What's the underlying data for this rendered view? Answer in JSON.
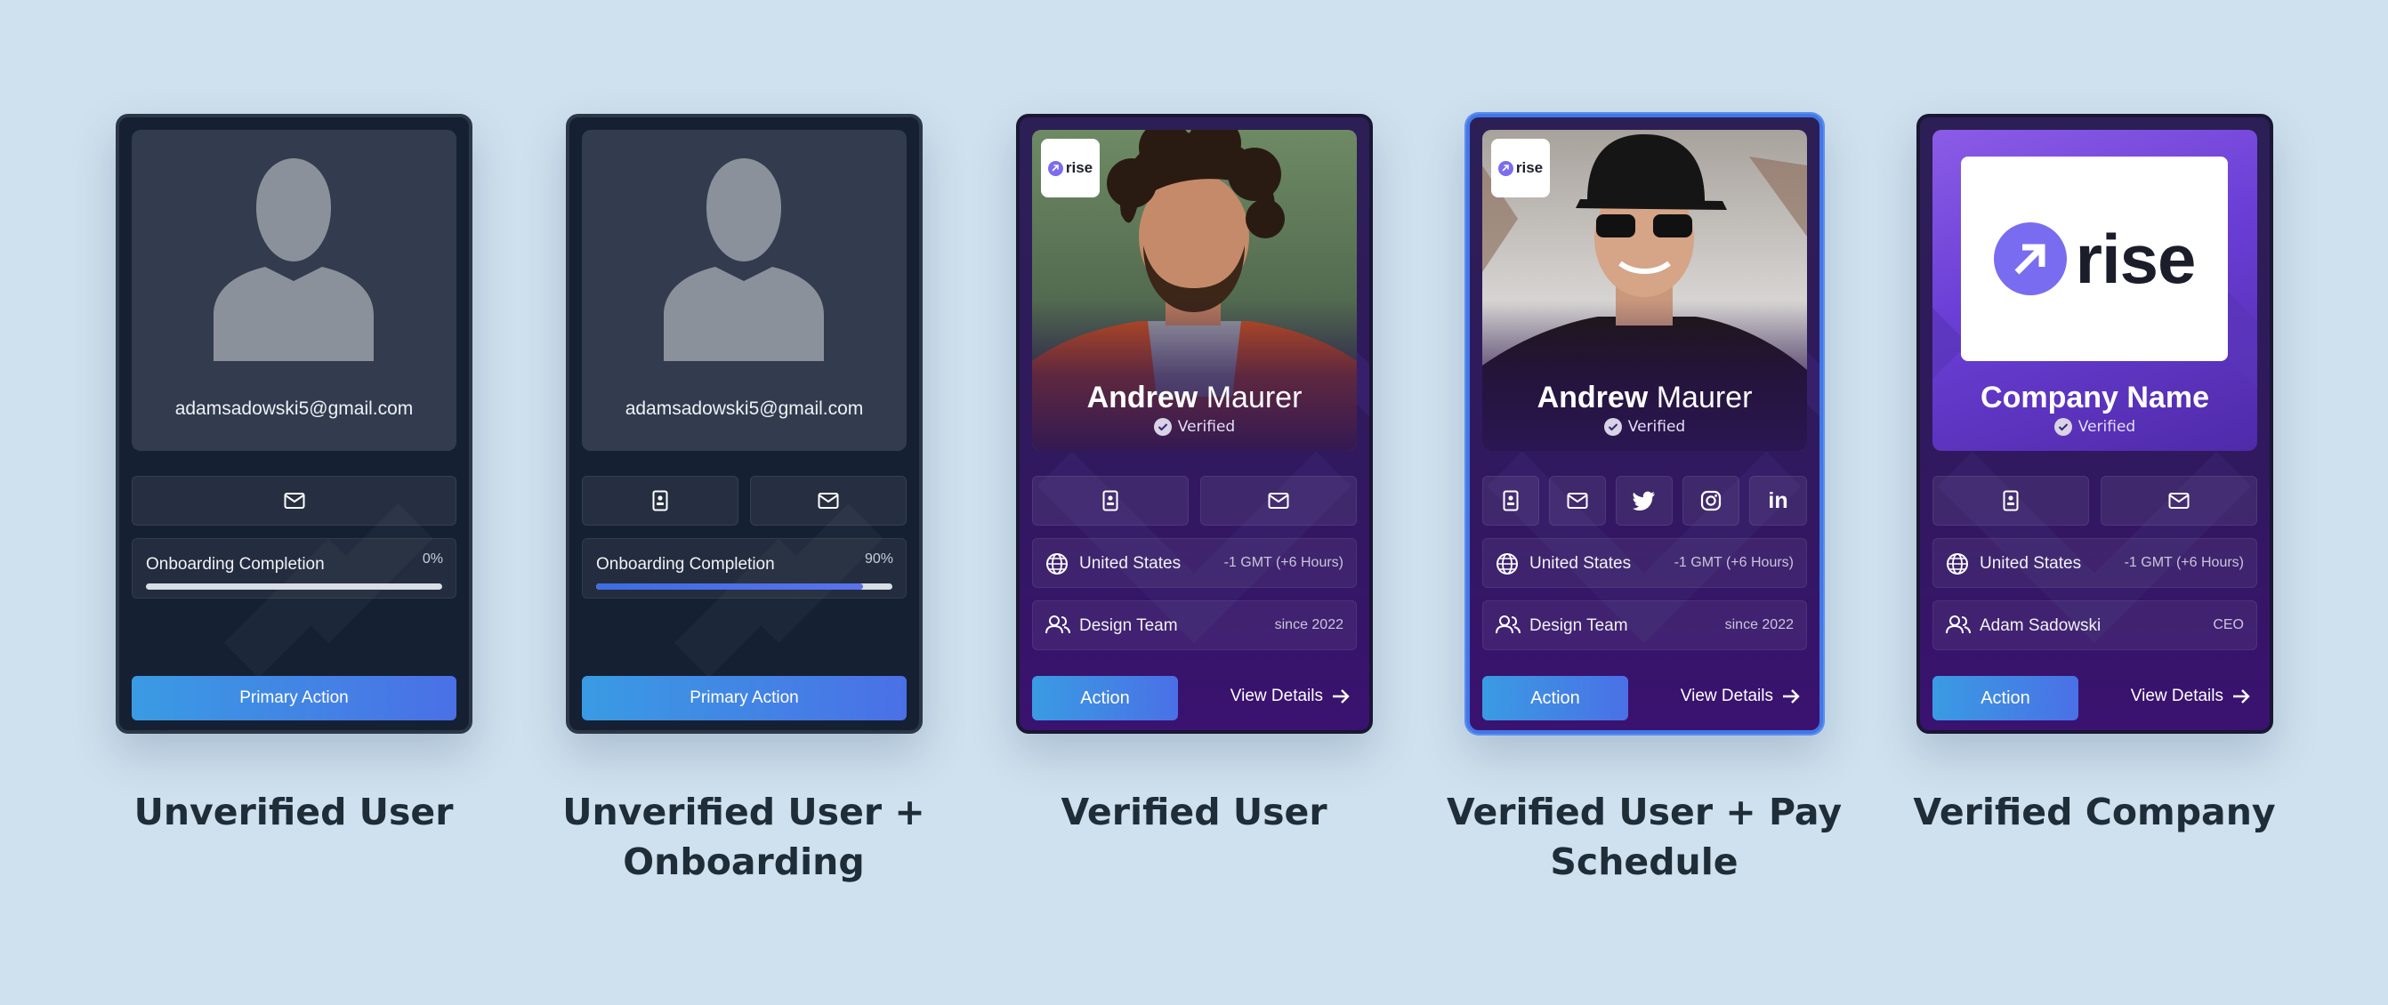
{
  "cards": [
    {
      "caption": [
        "Unverified User"
      ],
      "email": "adamsadowski5@gmail.com",
      "progress_label": "Onboarding Completion",
      "progress_value": "0%",
      "progress_fraction": 0,
      "button": "Primary Action",
      "icons": [
        "mail-icon"
      ]
    },
    {
      "caption": [
        "Unverified User +",
        "Onboarding"
      ],
      "email": "adamsadowski5@gmail.com",
      "progress_label": "Onboarding Completion",
      "progress_value": "90%",
      "progress_fraction": 0.9,
      "button": "Primary Action",
      "icons": [
        "id-card-icon",
        "mail-icon"
      ]
    },
    {
      "caption": [
        "Verified User"
      ],
      "logo": "rise",
      "first_name": "Andrew",
      "last_name": "Maurer",
      "verified": "Verified",
      "country": "United States",
      "timezone": "-1 GMT (+6 Hours)",
      "team": "Design Team",
      "since": "since 2022",
      "action": "Action",
      "details": "View Details",
      "icons": [
        "id-card-icon",
        "mail-icon"
      ]
    },
    {
      "caption": [
        "Verified User + Pay",
        "Schedule"
      ],
      "logo": "rise",
      "first_name": "Andrew",
      "last_name": "Maurer",
      "verified": "Verified",
      "country": "United States",
      "timezone": "-1 GMT (+6 Hours)",
      "team": "Design Team",
      "since": "since 2022",
      "action": "Action",
      "details": "View Details",
      "icons": [
        "id-card-icon",
        "mail-icon",
        "twitter-icon",
        "instagram-icon",
        "linkedin-icon"
      ],
      "linkedin": "in"
    },
    {
      "caption": [
        "Verified Company"
      ],
      "logo": "rise",
      "company_name": "Company Name",
      "verified": "Verified",
      "country": "United States",
      "timezone": "-1 GMT (+6 Hours)",
      "contact": "Adam Sadowski",
      "role": "CEO",
      "action": "Action",
      "details": "View Details",
      "icons": [
        "id-card-icon",
        "mail-icon"
      ]
    }
  ],
  "colors": {
    "page_bg": "#cfe1ee",
    "card_dark": "#162033",
    "card_purple": "#30195e",
    "button_gradient_start": "#3a9be3",
    "button_gradient_end": "#4a70e6",
    "selected_border": "#4277e8"
  }
}
